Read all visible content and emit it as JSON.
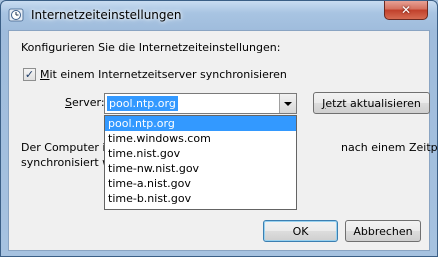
{
  "window": {
    "title": "Internetzeiteinstellungen",
    "close_glyph": "✕"
  },
  "heading": "Konfigurieren Sie die Internetzeiteinstellungen:",
  "sync": {
    "checked": true,
    "label_mnemonic": "M",
    "label_rest": "it einem Internetzeitserver synchronisieren"
  },
  "server": {
    "label_mnemonic": "S",
    "label_rest": "erver:",
    "value": "pool.ntp.org",
    "options": [
      "pool.ntp.org",
      "time.windows.com",
      "time.nist.gov",
      "time-nw.nist.gov",
      "time-a.nist.gov",
      "time-b.nist.gov"
    ],
    "selected_index": 0
  },
  "update_button": {
    "mnemonic": "J",
    "rest": "etzt aktualisieren"
  },
  "description": {
    "line1_start": "Der Computer i",
    "line1_end": "nach einem Zeitplan",
    "line2_start": "synchronisiert w"
  },
  "buttons": {
    "ok": "OK",
    "cancel": "Abbrechen"
  }
}
